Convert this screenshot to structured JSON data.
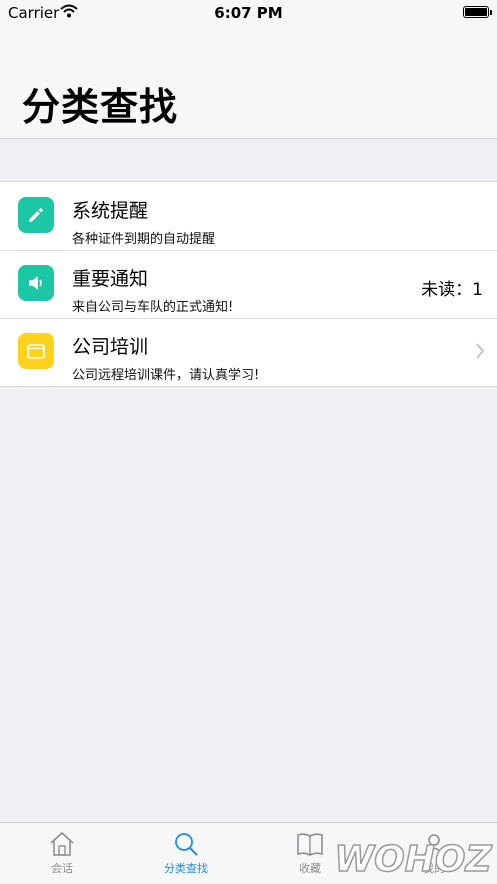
{
  "status": {
    "carrier": "Carrier",
    "time": "6:07 PM"
  },
  "header": {
    "title": "分类查找"
  },
  "rows": [
    {
      "title": "系统提醒",
      "subtitle": "各种证件到期的自动提醒",
      "icon": "pencil-icon",
      "color": "#1dc6a5"
    },
    {
      "title": "重要通知",
      "subtitle": "来自公司与车队的正式通知!",
      "unread": "未读：1",
      "icon": "speaker-icon",
      "color": "#1dc6a5"
    },
    {
      "title": "公司培训",
      "subtitle": "公司远程培训课件，请认真学习!",
      "icon": "folder-icon",
      "color": "#ffd21e"
    }
  ],
  "tabs": [
    {
      "label": "会话",
      "icon": "home-icon"
    },
    {
      "label": "分类查找",
      "icon": "search-icon"
    },
    {
      "label": "收藏",
      "icon": "book-icon"
    },
    {
      "label": "我的",
      "icon": "profile-icon"
    }
  ],
  "active_color": "#1a8cff",
  "watermark": "WOHOZ"
}
